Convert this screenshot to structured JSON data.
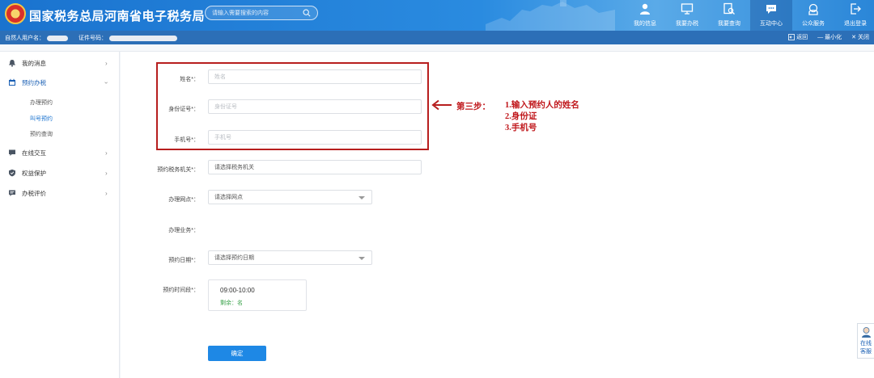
{
  "header": {
    "site_title": "国家税务总局河南省电子税务局",
    "search_placeholder": "请输入需要搜索的内容",
    "nav": [
      {
        "label": "我的信息",
        "icon": "user-icon"
      },
      {
        "label": "我要办税",
        "icon": "monitor-icon"
      },
      {
        "label": "我要查询",
        "icon": "document-search-icon"
      },
      {
        "label": "互动中心",
        "icon": "chat-icon"
      },
      {
        "label": "公众服务",
        "icon": "service-icon"
      },
      {
        "label": "退出登录",
        "icon": "logout-icon"
      }
    ],
    "active_nav": "互动中心"
  },
  "userbar": {
    "user_label": "自然人用户名：",
    "id_label": "证件号码：",
    "back": "返回",
    "minimize": "最小化",
    "close": "关闭"
  },
  "sidebar": {
    "items": [
      {
        "label": "我的消息",
        "icon": "bell-icon"
      },
      {
        "label": "预约办税",
        "icon": "calendar-icon"
      },
      {
        "label": "在线交互",
        "icon": "chat-icon"
      },
      {
        "label": "权益保护",
        "icon": "shield-icon"
      },
      {
        "label": "办税评价",
        "icon": "comment-icon"
      }
    ],
    "sub_items": [
      "办理预约",
      "叫号预约",
      "预约查询"
    ],
    "active_sub": "叫号预约"
  },
  "form": {
    "name_label": "姓名*：",
    "name_placeholder": "姓名",
    "id_label": "身份证号*：",
    "id_placeholder": "身份证号",
    "phone_label": "手机号*：",
    "phone_placeholder": "手机号",
    "office_label": "预约税务机关*：",
    "office_value": "请选择税务机关",
    "site_label": "办理网点*：",
    "site_value": "请选择网点",
    "business_label": "办理业务*：",
    "date_label": "预约日期*：",
    "date_value": "请选择预约日期",
    "time_label": "预约时间段*：",
    "time_slot": "09:00-10:00",
    "remaining": "剩余：名",
    "confirm": "确定"
  },
  "annotation": {
    "step_label": "第三步：",
    "lines": [
      "1.输入预约人的姓名",
      "2.身份证",
      "3.手机号"
    ]
  },
  "widget": {
    "label": "在线客服"
  },
  "colors": {
    "header_blue": "#1a73cf",
    "userbar_blue": "#2c6fb7",
    "annotation_red": "#c0181c",
    "confirm_blue": "#1e88e5",
    "remaining_green": "#39a24a"
  }
}
